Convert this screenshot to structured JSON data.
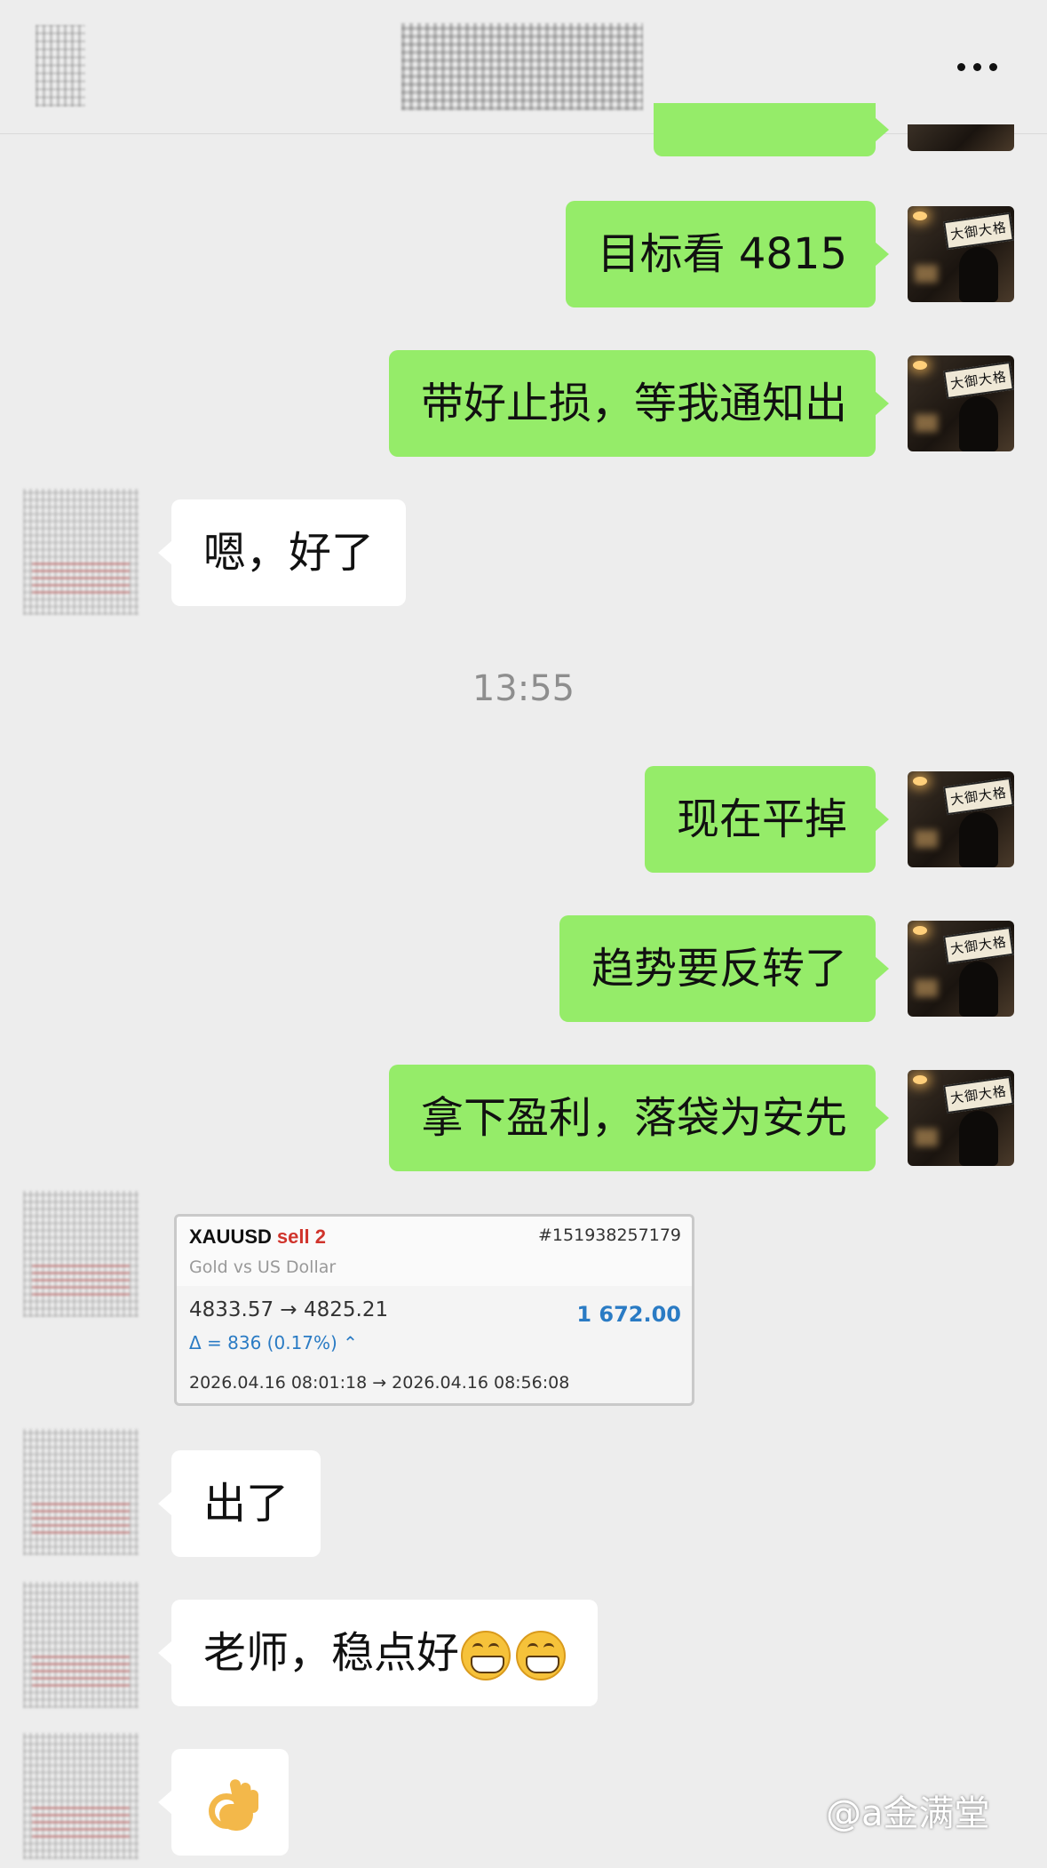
{
  "header": {
    "menu_icon": "more-icon"
  },
  "messages": [
    {
      "side": "right",
      "text": ""
    },
    {
      "side": "right",
      "text": "目标看 4815"
    },
    {
      "side": "right",
      "text": "带好止损，等我通知出"
    },
    {
      "side": "left",
      "text": "嗯，好了"
    },
    {
      "type": "time",
      "text": "13:55"
    },
    {
      "side": "right",
      "text": "现在平掉"
    },
    {
      "side": "right",
      "text": "趋势要反转了"
    },
    {
      "side": "right",
      "text": "拿下盈利，落袋为安先"
    },
    {
      "side": "left",
      "type": "trade-card"
    },
    {
      "side": "left",
      "text": "出了"
    },
    {
      "side": "left",
      "text": "老师，稳点好",
      "emoji": [
        "grin-icon",
        "grin-icon"
      ]
    },
    {
      "side": "left",
      "emoji": [
        "ok-hand-icon"
      ]
    }
  ],
  "trade_card": {
    "symbol": "XAUUSD",
    "side": "sell 2",
    "ticket": "#151938257179",
    "description": "Gold vs US Dollar",
    "prices": "4833.57 → 4825.21",
    "profit": "1 672.00",
    "delta": "Δ = 836 (0.17%) ⌃",
    "times": "2026.04.16 08:01:18 → 2026.04.16 08:56:08"
  },
  "avatar_me": {
    "sign_text": "大御大格"
  },
  "watermark": {
    "text": "@a金满堂"
  },
  "colors": {
    "background": "#ededed",
    "bubble_me": "#95ec69",
    "bubble_other": "#ffffff",
    "sell_red": "#d0342c",
    "profit_blue": "#2a7bc4"
  }
}
